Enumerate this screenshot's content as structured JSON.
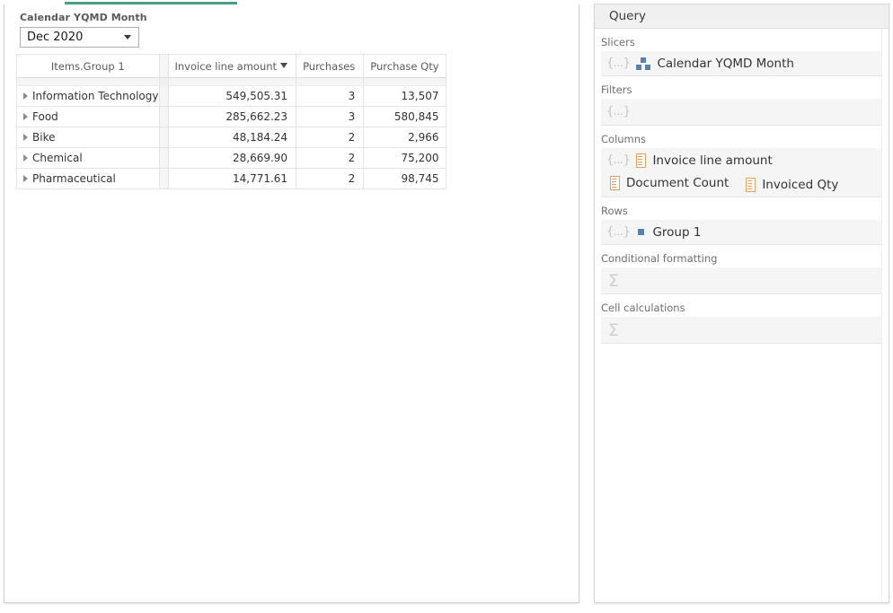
{
  "report": {
    "slicer": {
      "label": "Calendar YQMD Month",
      "selected_value": "Dec 2020",
      "caret_icon": "chevron-down-icon"
    },
    "table": {
      "columns": [
        {
          "key": "group",
          "header": "Items.Group 1",
          "align": "center"
        },
        {
          "key": "amount",
          "header": "Invoice line amount",
          "align": "center",
          "sorted": true,
          "sort_direction": "desc"
        },
        {
          "key": "purchases",
          "header": "Purchases",
          "align": "center"
        },
        {
          "key": "qty",
          "header": "Purchase Qty",
          "align": "center"
        }
      ],
      "rows": [
        {
          "group": "Information Technology",
          "amount": "549,505.31",
          "purchases": "3",
          "qty": "13,507"
        },
        {
          "group": "Food",
          "amount": "285,662.23",
          "purchases": "3",
          "qty": "580,845"
        },
        {
          "group": "Bike",
          "amount": "48,184.24",
          "purchases": "2",
          "qty": "2,966"
        },
        {
          "group": "Chemical",
          "amount": "28,669.90",
          "purchases": "2",
          "qty": "75,200"
        },
        {
          "group": "Pharmaceutical",
          "amount": "14,771.61",
          "purchases": "2",
          "qty": "98,745"
        }
      ]
    }
  },
  "query_panel": {
    "title": "Query",
    "placeholder_glyph": "{...}",
    "sigma_glyph": "Σ",
    "sections": [
      {
        "label": "Slicers",
        "items": [
          {
            "text": "Calendar YQMD Month",
            "icon": "hierarchy-icon"
          }
        ]
      },
      {
        "label": "Filters",
        "items": []
      },
      {
        "label": "Columns",
        "items": [
          {
            "text": "Invoice line amount",
            "icon": "measure-icon"
          },
          {
            "text": "Document Count",
            "icon": "measure-icon"
          },
          {
            "text": "Invoiced Qty",
            "icon": "measure-icon"
          }
        ]
      },
      {
        "label": "Rows",
        "items": [
          {
            "text": "Group 1",
            "icon": "dimension-icon"
          }
        ]
      },
      {
        "label": "Conditional formatting",
        "items": []
      },
      {
        "label": "Cell calculations",
        "items": []
      }
    ]
  },
  "theme": {
    "tab_accent": "#4c9e85",
    "hierarchy_icon_color": "#5b7fb0",
    "measure_icon_color": "#e0a060",
    "panel_header_bg": "#f0f0f0",
    "dropzone_bg": "#f5f5f5"
  }
}
